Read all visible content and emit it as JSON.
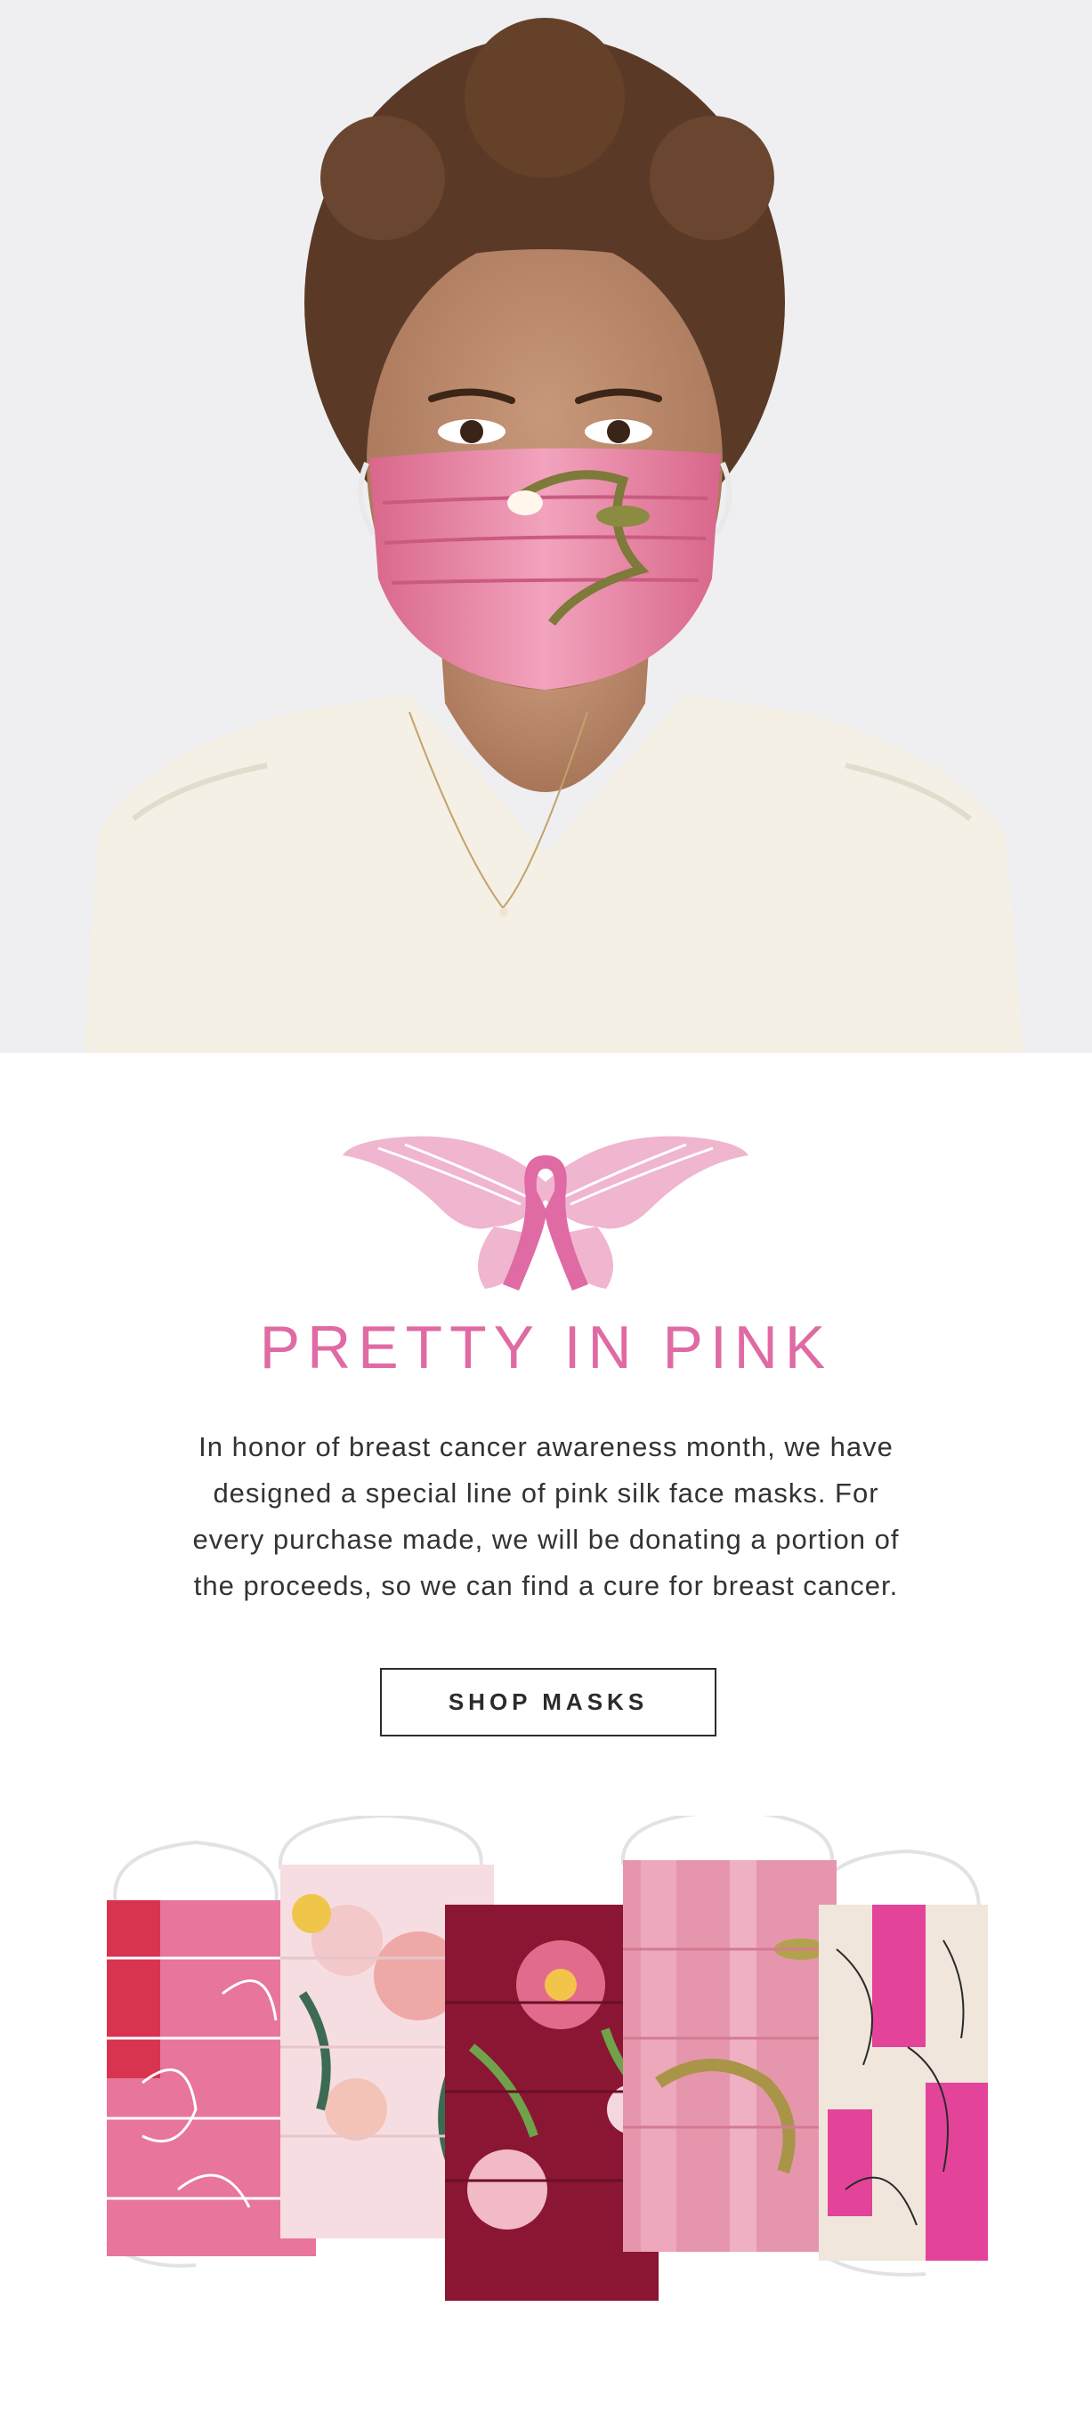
{
  "hero": {
    "image": "woman-wearing-pink-floral-silk-mask"
  },
  "logo": {
    "icon": "butterfly-pink-ribbon-icon"
  },
  "title": "PRETTY IN PINK",
  "body_lines": [
    "In honor of breast cancer awareness month, we have",
    "designed a special line of pink silk face masks. For",
    "every purchase made, we will be donating a portion of",
    "the proceeds, so we can find a cure for breast cancer."
  ],
  "cta_label": "SHOP MASKS",
  "colors": {
    "accent_pink": "#e06aa3",
    "text": "#2b2b2b",
    "hero_bg": "#efeff1",
    "mask_pink": "#e8759b",
    "mask_burgundy": "#8a1633",
    "mask_hot_pink": "#e3449a"
  },
  "masks": [
    {
      "name": "pink-paisley-bandana-mask"
    },
    {
      "name": "blush-floral-mask"
    },
    {
      "name": "burgundy-floral-mask"
    },
    {
      "name": "metallic-pink-floral-mask"
    },
    {
      "name": "hot-pink-botanical-line-mask"
    }
  ]
}
